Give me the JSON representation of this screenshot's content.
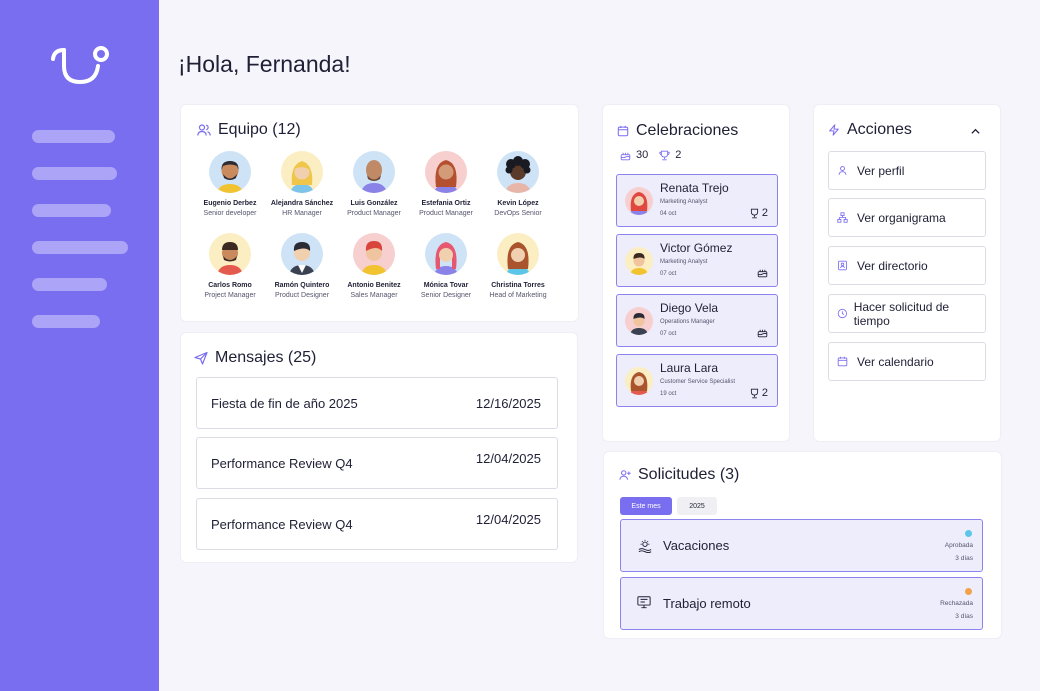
{
  "greeting": "¡Hola, Fernanda!",
  "colors": {
    "sidebar": "#7a6ef0",
    "accent": "#7a6ef0",
    "card_highlight": "#ededfc",
    "approved": "#5cc6e8",
    "rejected": "#f2a24a"
  },
  "team": {
    "title": "Equipo (12)",
    "members": [
      {
        "name": "Eugenio Derbez",
        "role": "Senior developer",
        "icon": "avatar-man-beard"
      },
      {
        "name": "Alejandra Sánchez",
        "role": "HR Manager",
        "icon": "avatar-woman-blonde"
      },
      {
        "name": "Luis González",
        "role": "Product Manager",
        "icon": "avatar-man-bald"
      },
      {
        "name": "Estefania Ortiz",
        "role": "Product Manager",
        "icon": "avatar-woman-redhair"
      },
      {
        "name": "Kevin López",
        "role": "DevOps Senior",
        "icon": "avatar-man-curly"
      },
      {
        "name": "Carlos Romo",
        "role": "Project Manager",
        "icon": "avatar-man-glasses"
      },
      {
        "name": "Ramón Quintero",
        "role": "Product Designer",
        "icon": "avatar-man-shirt"
      },
      {
        "name": "Antonio Benitez",
        "role": "Sales Manager",
        "icon": "avatar-man-red"
      },
      {
        "name": "Mónica Tovar",
        "role": "Senior Designer",
        "icon": "avatar-woman-pink"
      },
      {
        "name": "Christina Torres",
        "role": "Head of Marketing",
        "icon": "avatar-woman-brown"
      }
    ]
  },
  "messages": {
    "title": "Mensajes (25)",
    "items": [
      {
        "title": "Fiesta de fin de año 2025",
        "date": "12/16/2025"
      },
      {
        "title": "Performance Review Q4",
        "date": "12/04/2025"
      },
      {
        "title": "Performance Review Q4",
        "date": "12/04/2025"
      }
    ]
  },
  "celebrations": {
    "title": "Celebraciones",
    "birthdays_count": "30",
    "anniversaries_count": "2",
    "items": [
      {
        "name": "Renata Trejo",
        "role": "Marketing Analyst",
        "date": "04 oct",
        "badge": "2",
        "badge_icon": "trophy-icon"
      },
      {
        "name": "Victor Gómez",
        "role": "Marketing Analyst",
        "date": "07 oct",
        "badge": "",
        "badge_icon": "cake-icon"
      },
      {
        "name": "Diego Vela",
        "role": "Operations Manager",
        "date": "07 oct",
        "badge": "",
        "badge_icon": "cake-icon"
      },
      {
        "name": "Laura Lara",
        "role": "Customer Service Specialist",
        "date": "19 oct",
        "badge": "2",
        "badge_icon": "trophy-icon"
      }
    ]
  },
  "actions": {
    "title": "Acciones",
    "items": [
      {
        "label": "Ver perfil",
        "icon": "user-icon"
      },
      {
        "label": "Ver organigrama",
        "icon": "org-chart-icon"
      },
      {
        "label": "Ver directorio",
        "icon": "directory-icon"
      },
      {
        "label": "Hacer solicitud de tiempo",
        "icon": "clock-icon"
      },
      {
        "label": "Ver calendario",
        "icon": "calendar-icon"
      }
    ]
  },
  "requests": {
    "title": "Solicitudes (3)",
    "filters": [
      "Este mes",
      "2025"
    ],
    "items": [
      {
        "title": "Vacaciones",
        "status": "Aprobada",
        "days": "3 días",
        "icon": "sun-icon"
      },
      {
        "title": "Trabajo remoto",
        "status": "Rechazada",
        "days": "3 días",
        "icon": "monitor-icon"
      }
    ]
  }
}
